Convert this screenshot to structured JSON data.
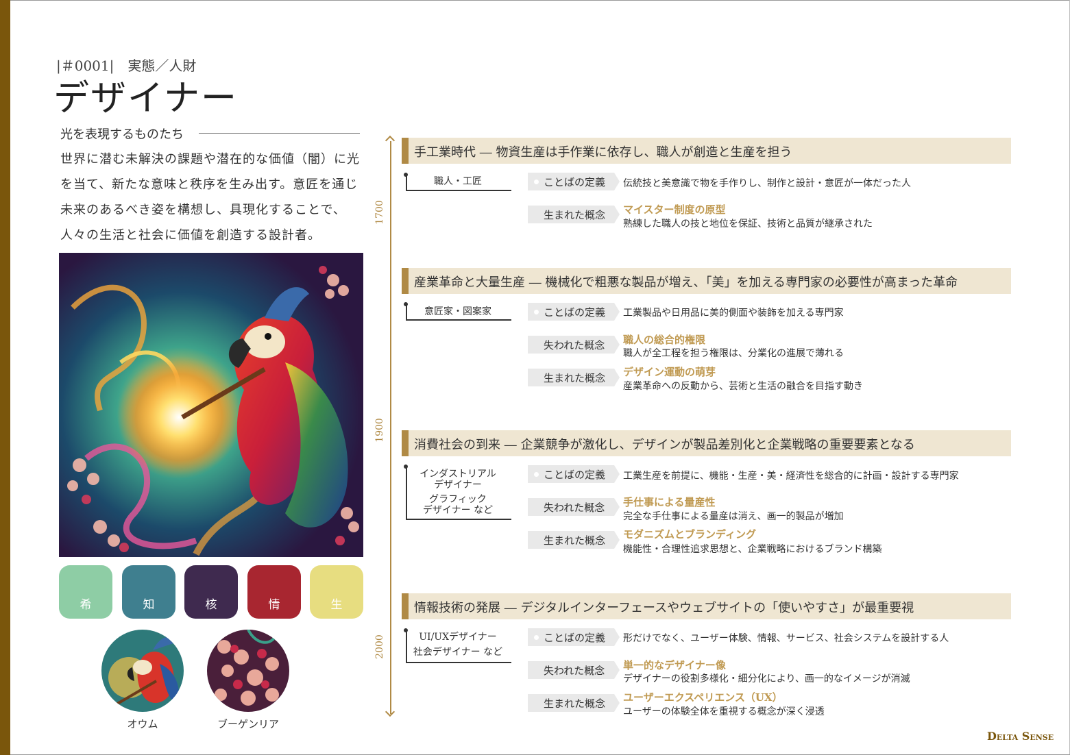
{
  "header": {
    "id": "|＃0001|　実態／人財",
    "title": "デザイナー",
    "tagline": "光を表現するものたち",
    "description": "世界に潜む未解決の課題や潜在的な価値（闇）に光を当て、新たな意味と秩序を生み出す。意匠を通じ未来のあるべき姿を構想し、具現化することで、人々の生活と社会に価値を創造する設計者。"
  },
  "swatches": [
    {
      "label": "希",
      "color": "#8ecda5"
    },
    {
      "label": "知",
      "color": "#3f7f8f"
    },
    {
      "label": "核",
      "color": "#3f2a4f"
    },
    {
      "label": "情",
      "color": "#a82630"
    },
    {
      "label": "生",
      "color": "#e7dd80"
    }
  ],
  "motifs": [
    {
      "label": "オウム"
    },
    {
      "label": "ブーゲンリア"
    }
  ],
  "timeline": {
    "years": [
      "1700",
      "1900",
      "2000"
    ],
    "eras": [
      {
        "title": "手工業時代 ― 物資生産は手作業に依存し、職人が創造と生産を担う",
        "role": "職人・工匠",
        "tags": {
          "def": "ことばの定義",
          "born": "生まれた概念"
        },
        "definition": "伝統技と美意識で物を手作りし、制作と設計・意匠が一体だった人",
        "born": {
          "title": "マイスター制度の原型",
          "desc": "熟練した職人の技と地位を保証、技術と品質が継承された"
        }
      },
      {
        "title": "産業革命と大量生産 ― 機械化で粗悪な製品が増え、「美」を加える専門家の必要性が高まった革命",
        "role": "意匠家・図案家",
        "tags": {
          "def": "ことばの定義",
          "lost": "失われた概念",
          "born": "生まれた概念"
        },
        "definition": "工業製品や日用品に美的側面や装飾を加える専門家",
        "lost": {
          "title": "職人の総合的権限",
          "desc": "職人が全工程を担う権限は、分業化の進展で薄れる"
        },
        "born": {
          "title": "デザイン運動の萌芽",
          "desc": "産業革命への反動から、芸術と生活の融合を目指す動き"
        }
      },
      {
        "title": "消費社会の到来 ― 企業競争が激化し、デザインが製品差別化と企業戦略の重要要素となる",
        "role_lines": [
          "インダストリアル",
          "デザイナー",
          "グラフィック",
          "デザイナー など"
        ],
        "tags": {
          "def": "ことばの定義",
          "lost": "失われた概念",
          "born": "生まれた概念"
        },
        "definition": "工業生産を前提に、機能・生産・美・経済性を総合的に計画・設計する専門家",
        "lost": {
          "title": "手仕事による量産性",
          "desc": "完全な手仕事による量産は消え、画一的製品が増加"
        },
        "born": {
          "title": "モダニズムとブランディング",
          "desc": "機能性・合理性追求思想と、企業戦略におけるブランド構築"
        }
      },
      {
        "title": "情報技術の発展 ― デジタルインターフェースやウェブサイトの「使いやすさ」が最重要視",
        "role_lines": [
          "UI/UXデザイナー",
          "社会デザイナー など"
        ],
        "tags": {
          "def": "ことばの定義",
          "lost": "失われた概念",
          "born": "生まれた概念"
        },
        "definition": "形だけでなく、ユーザー体験、情報、サービス、社会システムを設計する人",
        "lost": {
          "title": "単一的なデザイナー像",
          "desc": "デザイナーの役割多様化・細分化により、画一的なイメージが消滅"
        },
        "born": {
          "title": "ユーザーエクスペリエンス（UX）",
          "desc": "ユーザーの体験全体を重視する概念が深く浸透"
        }
      }
    ]
  },
  "brand": {
    "logo": "Delta Sense"
  }
}
